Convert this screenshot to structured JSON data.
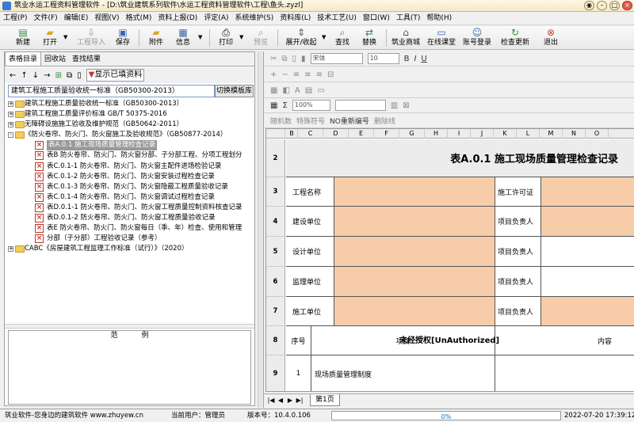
{
  "window": {
    "title": "筑业水运工程资料管理软件 - [D:\\筑业建筑系列软件\\水运工程资料管理软件\\工程\\鱼头.zyzl]"
  },
  "menu": [
    "工程(P)",
    "文件(F)",
    "编辑(E)",
    "视图(V)",
    "格式(M)",
    "资料上报(D)",
    "评定(A)",
    "系统维护(S)",
    "资料库(L)",
    "技术工艺(U)",
    "窗口(W)",
    "工具(T)",
    "帮助(H)"
  ],
  "toolbar": {
    "new": "新建",
    "open": "打开",
    "import": "工程导入",
    "save": "保存",
    "attach": "附件",
    "info": "信息",
    "print": "打印",
    "preview": "预览",
    "expand": "展开/收起",
    "find": "查找",
    "replace": "替换",
    "mall": "筑业商城",
    "classroom": "在线课堂",
    "login": "账号登录",
    "update": "检查更新",
    "exit": "退出"
  },
  "left": {
    "tabs": [
      "表格目录",
      "回收站",
      "查找结果"
    ],
    "show_existing": "显示已填资料",
    "standard_select": "建筑工程施工质量验收统一标准（GB50300-2013）",
    "switch_button": "切换模板库",
    "tree": [
      {
        "level": 0,
        "kind": "folder",
        "exp": "+",
        "text": "建筑工程施工质量验收统一标准（GB50300-2013）"
      },
      {
        "level": 0,
        "kind": "folder",
        "exp": "+",
        "text": "建筑工程施工质量评价标准 GB/T 50375-2016"
      },
      {
        "level": 0,
        "kind": "folder",
        "exp": "+",
        "text": "无障碍设施施工验收及维护规范（GB50642-2011）"
      },
      {
        "level": 0,
        "kind": "folder",
        "exp": "-",
        "text": "《防火卷帘、防火门、防火窗施工及验收规范》（GB50877-2014）"
      },
      {
        "level": 1,
        "kind": "table",
        "text": "表A.0.1 施工现场质量管理检查记录",
        "selected": true
      },
      {
        "level": 1,
        "kind": "table",
        "text": "表B 防火卷帘、防火门、防火窗分部、子分部工程、分项工程划分"
      },
      {
        "level": 1,
        "kind": "table",
        "text": "表C.0.1-1 防火卷帘、防火门、防火窗主配件进场检验记录"
      },
      {
        "level": 1,
        "kind": "table",
        "text": "表C.0.1-2 防火卷帘、防火门、防火窗安装过程检查记录"
      },
      {
        "level": 1,
        "kind": "table",
        "text": "表C.0.1-3 防火卷帘、防火门、防火窗隐蔽工程质量验收记录"
      },
      {
        "level": 1,
        "kind": "table",
        "text": "表C.0.1-4 防火卷帘、防火门、防火窗调试过程检查记录"
      },
      {
        "level": 1,
        "kind": "table",
        "text": "表D.0.1-1 防火卷帘、防火门、防火窗工程质量控制资料核查记录"
      },
      {
        "level": 1,
        "kind": "table",
        "text": "表D.0.1-2 防火卷帘、防火门、防火窗工程质量验收记录"
      },
      {
        "level": 1,
        "kind": "table",
        "text": "表E 防火卷帘、防火门、防火窗每日（季、年）检查、使用和管理"
      },
      {
        "level": 1,
        "kind": "table",
        "text": "分部（子分部）工程验收记录（参考）"
      },
      {
        "level": 0,
        "kind": "folder",
        "exp": "+",
        "text": "CABC《房屋建筑工程监理工作标准（试行）》（2020）"
      }
    ],
    "sample_title": "范例"
  },
  "format": {
    "font_name": "宋体",
    "font_size": "10",
    "zoom": "100%",
    "random": "随机数",
    "special": "特殊符号",
    "renumber": "NO重新编号",
    "delete_line": "删除线"
  },
  "sheet": {
    "columns": [
      "B",
      "C",
      "D",
      "E",
      "F",
      "G",
      "H",
      "I",
      "J",
      "K",
      "L",
      "M",
      "N",
      "O"
    ],
    "rows": [
      "2",
      "3",
      "4",
      "5",
      "6",
      "7",
      "8",
      "9"
    ],
    "title": "表A.0.1  施工现场质量管理检查记录",
    "labels": {
      "project_name": "工程名称",
      "permit": "施工许可证",
      "builder": "建设单位",
      "builder_lead": "项目负责人",
      "designer": "设计单位",
      "designer_lead": "项目负责人",
      "supervisor": "监理单位",
      "supervisor_lead": "项目负责人",
      "constructor": "施工单位",
      "constructor_lead": "项目负责人",
      "seq": "序号",
      "item": "项目",
      "content": "内容",
      "row1_seq": "1",
      "row1_item": "现场质量管理制度"
    },
    "watermark": "未经授权[UnAuthorized]",
    "tab": "第1页"
  },
  "status": {
    "brand": "筑业软件-您身边的建筑软件 www.zhuyew.cn",
    "user": "当前用户：管理员",
    "version": "版本号：10.4.0.106",
    "progress": "0%",
    "progress_value": 0,
    "datetime": "2022-07-20 17:39:12"
  }
}
